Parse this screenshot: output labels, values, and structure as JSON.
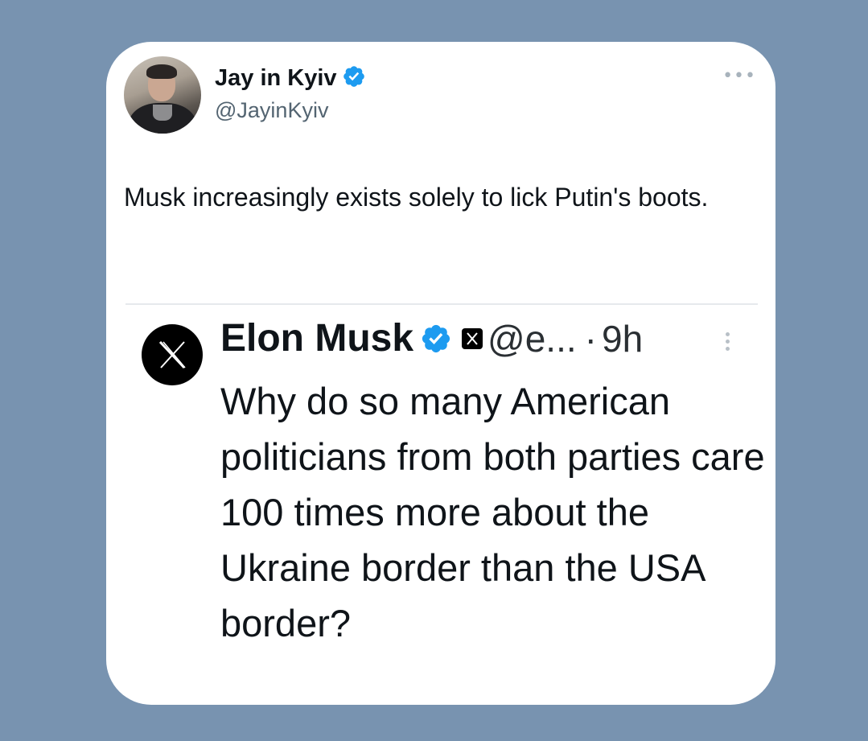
{
  "tweet": {
    "author": {
      "name": "Jay in Kyiv",
      "handle": "@JayinKyiv",
      "verified": true
    },
    "more_icon": "ellipsis-icon",
    "text": "Musk increasingly exists solely to lick Putin's boots."
  },
  "quoted_tweet": {
    "author": {
      "name": "Elon Musk",
      "handle": "@e...",
      "verified": true,
      "affiliate_badge": "x-logo-icon"
    },
    "separator": "·",
    "time": "9h",
    "text": "Why do so many American politicians from both parties care 100 times more about the Ukraine border than the USA border?"
  },
  "colors": {
    "background": "#7893b0",
    "card": "#ffffff",
    "verified_badge": "#1d9bf0",
    "primary_text": "#0f1419",
    "secondary_text": "#536471"
  }
}
